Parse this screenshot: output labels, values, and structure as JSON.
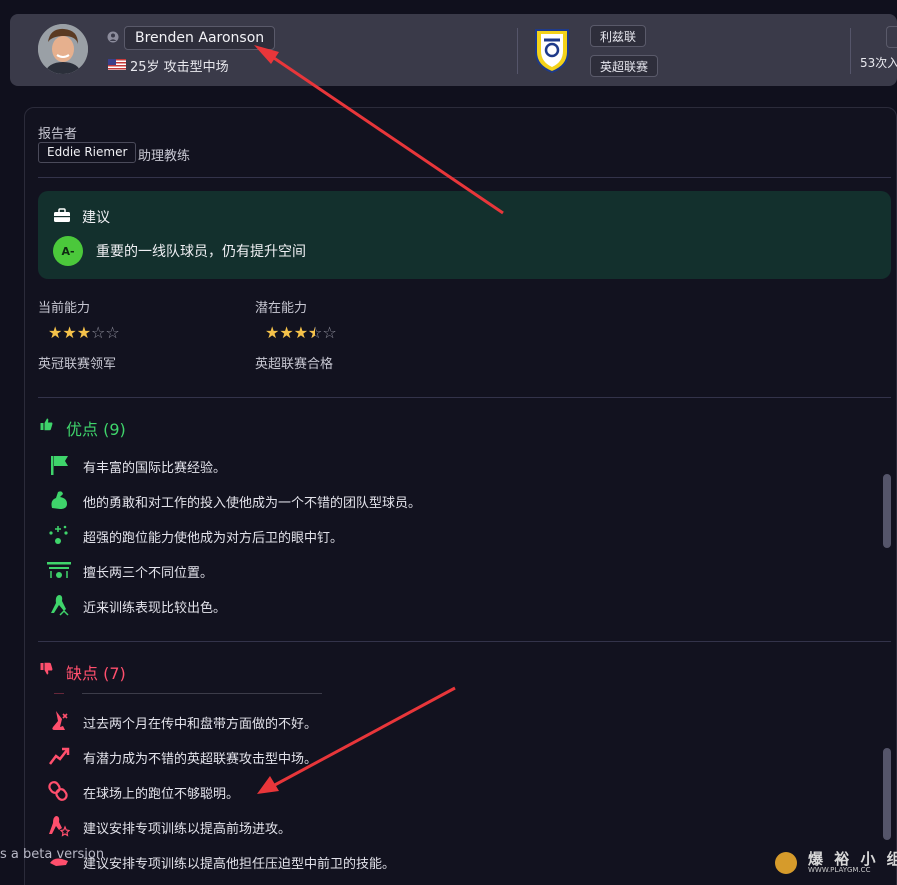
{
  "player": {
    "name": "Brenden Aaronson",
    "age_position": "25岁 攻击型中场",
    "club": "利兹联",
    "league": "英超联赛",
    "apps": "53次入"
  },
  "reporter": {
    "label": "报告者",
    "name": "Eddie Riemer",
    "role": "助理教练"
  },
  "advice": {
    "title": "建议",
    "grade": "A-",
    "text": "重要的一线队球员，仍有提升空间"
  },
  "ability": {
    "current_label": "当前能力",
    "current_stars": 3,
    "current_desc": "英冠联赛领军",
    "potential_label": "潜在能力",
    "potential_stars": 3.5,
    "potential_desc": "英超联赛合格"
  },
  "pros": {
    "title": "优点 (9)",
    "items": [
      {
        "icon": "flag-icon",
        "text": "有丰富的国际比赛经验。"
      },
      {
        "icon": "muscle-icon",
        "text": "他的勇敢和对工作的投入使他成为一个不错的团队型球员。"
      },
      {
        "icon": "movement-icon",
        "text": "超强的跑位能力使他成为对方后卫的眼中钉。"
      },
      {
        "icon": "positions-icon",
        "text": "擅长两三个不同位置。"
      },
      {
        "icon": "training-icon",
        "text": "近来训练表现比较出色。"
      }
    ]
  },
  "cons": {
    "title": "缺点 (7)",
    "items": [
      {
        "icon": "crossing-icon",
        "text": "过去两个月在传中和盘带方面做的不好。"
      },
      {
        "icon": "trend-icon",
        "text": "有潜力成为不错的英超联赛攻击型中场。"
      },
      {
        "icon": "link-icon",
        "text": "在球场上的跑位不够聪明。"
      },
      {
        "icon": "attack-training-icon",
        "text": "建议安排专项训练以提高前场进攻。"
      },
      {
        "icon": "pressing-training-icon",
        "text": "建议安排专项训练以提高他担任压迫型中前卫的技能。"
      }
    ]
  },
  "footer": {
    "beta": "s a beta version",
    "watermark": "爆 裕 小 组",
    "watermark_url": "WWW.PLAYGM.CC"
  },
  "colors": {
    "pros": "#3fd46b",
    "cons": "#ff4f6d",
    "accent_green": "#4bc83b",
    "star": "#f5c24a",
    "arrow": "#e8363a"
  }
}
